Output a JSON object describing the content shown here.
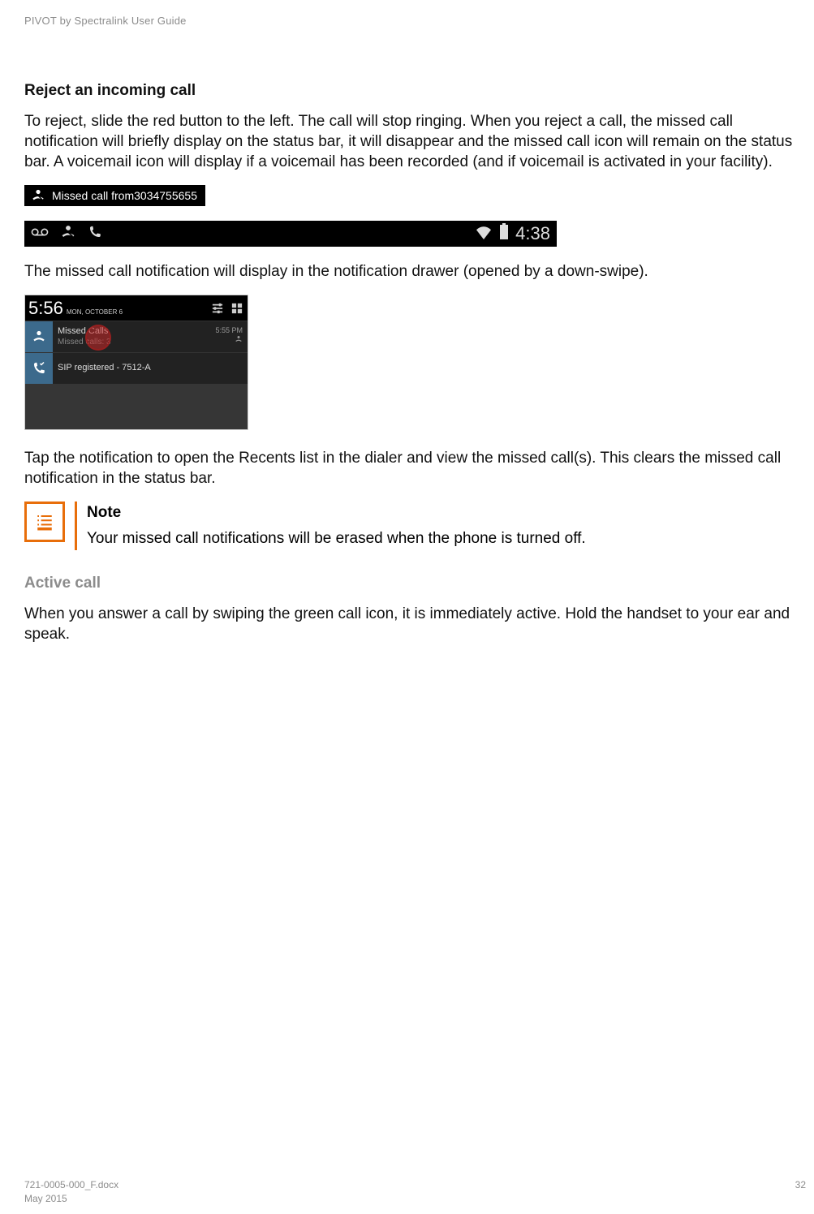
{
  "header": "PIVOT by Spectralink User Guide",
  "section1": {
    "title": "Reject an incoming call",
    "para1": "To reject, slide the red button to the left. The call will stop ringing. When you reject a call, the missed call notification will briefly display on the status bar, it will disappear and the missed call icon will remain on the status bar. A voicemail icon will display if a voicemail has been recorded (and if voicemail is activated in your facility).",
    "banner_text": "Missed call from3034755655",
    "status_bar_time": "4:38",
    "para2_after_statusbar": "The missed call notification will display in the notification drawer (opened by a down-swipe).",
    "drawer": {
      "clock": "5:56",
      "date": "MON, OCTOBER 6",
      "notif1_title": "Missed Calls",
      "notif1_sub": "Missed calls: 3",
      "notif1_time": "5:55 PM",
      "notif2_title": "SIP registered - 7512-A"
    },
    "para3": "Tap the notification to open the Recents list in the dialer and view the missed call(s). This clears the missed call notification in the status bar.",
    "note_label": "Note",
    "note_body": "Your missed call notifications will be erased when the phone is turned off."
  },
  "section2": {
    "title": "Active call",
    "para": "When you answer a call by swiping the green call icon, it is immediately active. Hold the handset to your ear and speak."
  },
  "footer": {
    "docnum": "721-0005-000_F.docx",
    "date": "May 2015",
    "page": "32"
  }
}
